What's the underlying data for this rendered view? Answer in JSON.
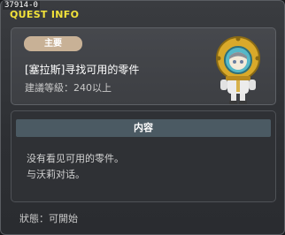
{
  "window": {
    "quest_id": "37914-0",
    "title": "QUEST INFO"
  },
  "header": {
    "badge_label": "主要",
    "quest_name": "[塞拉斯]寻找可用的零件",
    "level_requirement": "建議等級：240以上",
    "npc_icon": "diver-helmet-npc-icon"
  },
  "content": {
    "header_label": "内容",
    "lines": [
      "没有看见可用的零件。",
      "与沃莉对话。"
    ]
  },
  "status": {
    "text": "狀態：可開始"
  },
  "colors": {
    "title": "#f2e23a",
    "badge": "#c8b196",
    "content_header": "#4b5a63"
  }
}
